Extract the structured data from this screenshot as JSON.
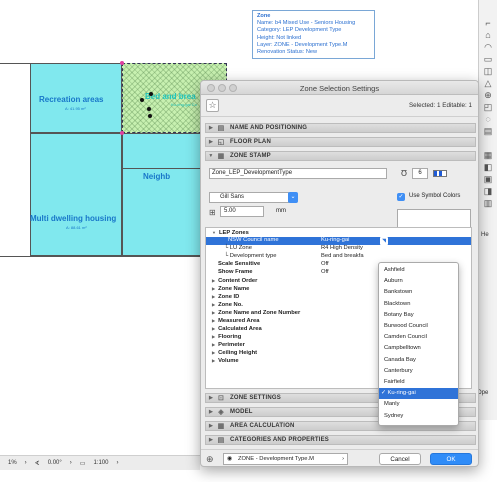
{
  "plan": {
    "zones": [
      {
        "name": "Recreation areas",
        "area": "A: 41.95 m²"
      },
      {
        "name": "Bed and brea",
        "area": "Ku-ring-gai Co"
      },
      {
        "name": "Multi dwelling housing",
        "area": "A: 88.61 m²"
      },
      {
        "name": "Neighb"
      }
    ],
    "tooltip": {
      "title": "Zone",
      "lines": [
        "Name: b4 Mixed Use - Seniors Housing",
        "Category: LEP Development Type",
        "Height: Not linked",
        "Layer: ZONE - Development Type.M",
        "Renovation Status: New"
      ]
    },
    "palette_label": "He",
    "palette_label2": "Ope"
  },
  "statusbar": {
    "zoom": "1%",
    "angle": "0.00°",
    "scale": "1:100"
  },
  "dialog": {
    "title": "Zone Selection Settings",
    "selected_info": "Selected: 1 Editable: 1",
    "sections": {
      "naming": "NAME AND POSITIONING",
      "floor_plan": "FLOOR PLAN",
      "zone_stamp": "ZONE STAMP",
      "zone_settings": "ZONE SETTINGS",
      "model": "MODEL",
      "area_calc": "AREA CALCULATION",
      "categories": "CATEGORIES AND PROPERTIES"
    },
    "stamp_name": "Zone_LEP_DevelopmentType",
    "stamp_version": "6",
    "font": "Gill Sans",
    "use_symbol_colors": "Use Symbol Colors",
    "size_value": "5.00",
    "size_unit": "mm",
    "tree": [
      {
        "key": "LEP Zones",
        "value": "",
        "bold": true
      },
      {
        "key": "NSW Council name",
        "value": "Ku-ring-gai",
        "bold": false
      },
      {
        "key": "LU Zone",
        "value": "R4 High Density",
        "bold": false
      },
      {
        "key": "Development type",
        "value": "Bed and breakfa",
        "bold": false
      },
      {
        "key": "Scale Sensitive",
        "value": "Off",
        "bold": true
      },
      {
        "key": "Show Frame",
        "value": "Off",
        "bold": true
      },
      {
        "key": "Content Order",
        "value": "",
        "bold": true
      },
      {
        "key": "Zone Name",
        "value": "",
        "bold": true
      },
      {
        "key": "Zone ID",
        "value": "",
        "bold": true
      },
      {
        "key": "Zone No.",
        "value": "",
        "bold": true
      },
      {
        "key": "Zone Name and Zone Number",
        "value": "",
        "bold": true
      },
      {
        "key": "Measured Area",
        "value": "",
        "bold": true
      },
      {
        "key": "Calculated Area",
        "value": "",
        "bold": true
      },
      {
        "key": "Flooring",
        "value": "",
        "bold": true
      },
      {
        "key": "Perimeter",
        "value": "",
        "bold": true
      },
      {
        "key": "Ceiling Height",
        "value": "",
        "bold": true
      },
      {
        "key": "Volume",
        "value": "",
        "bold": true
      }
    ],
    "dropdown": [
      "Ashfield",
      "Auburn",
      "Bankstown",
      "Blacktown",
      "Botany Bay",
      "Burwood Council",
      "Camden Council",
      "Campbelltown",
      "Canada Bay",
      "Canterbury",
      "Fairfield",
      "✓ Ku-ring-gai",
      "Manly",
      "Sydney"
    ],
    "dropdown_selected_index": 11,
    "layer": "ZONE - Development Type.M",
    "cancel": "Cancel",
    "ok": "OK"
  }
}
